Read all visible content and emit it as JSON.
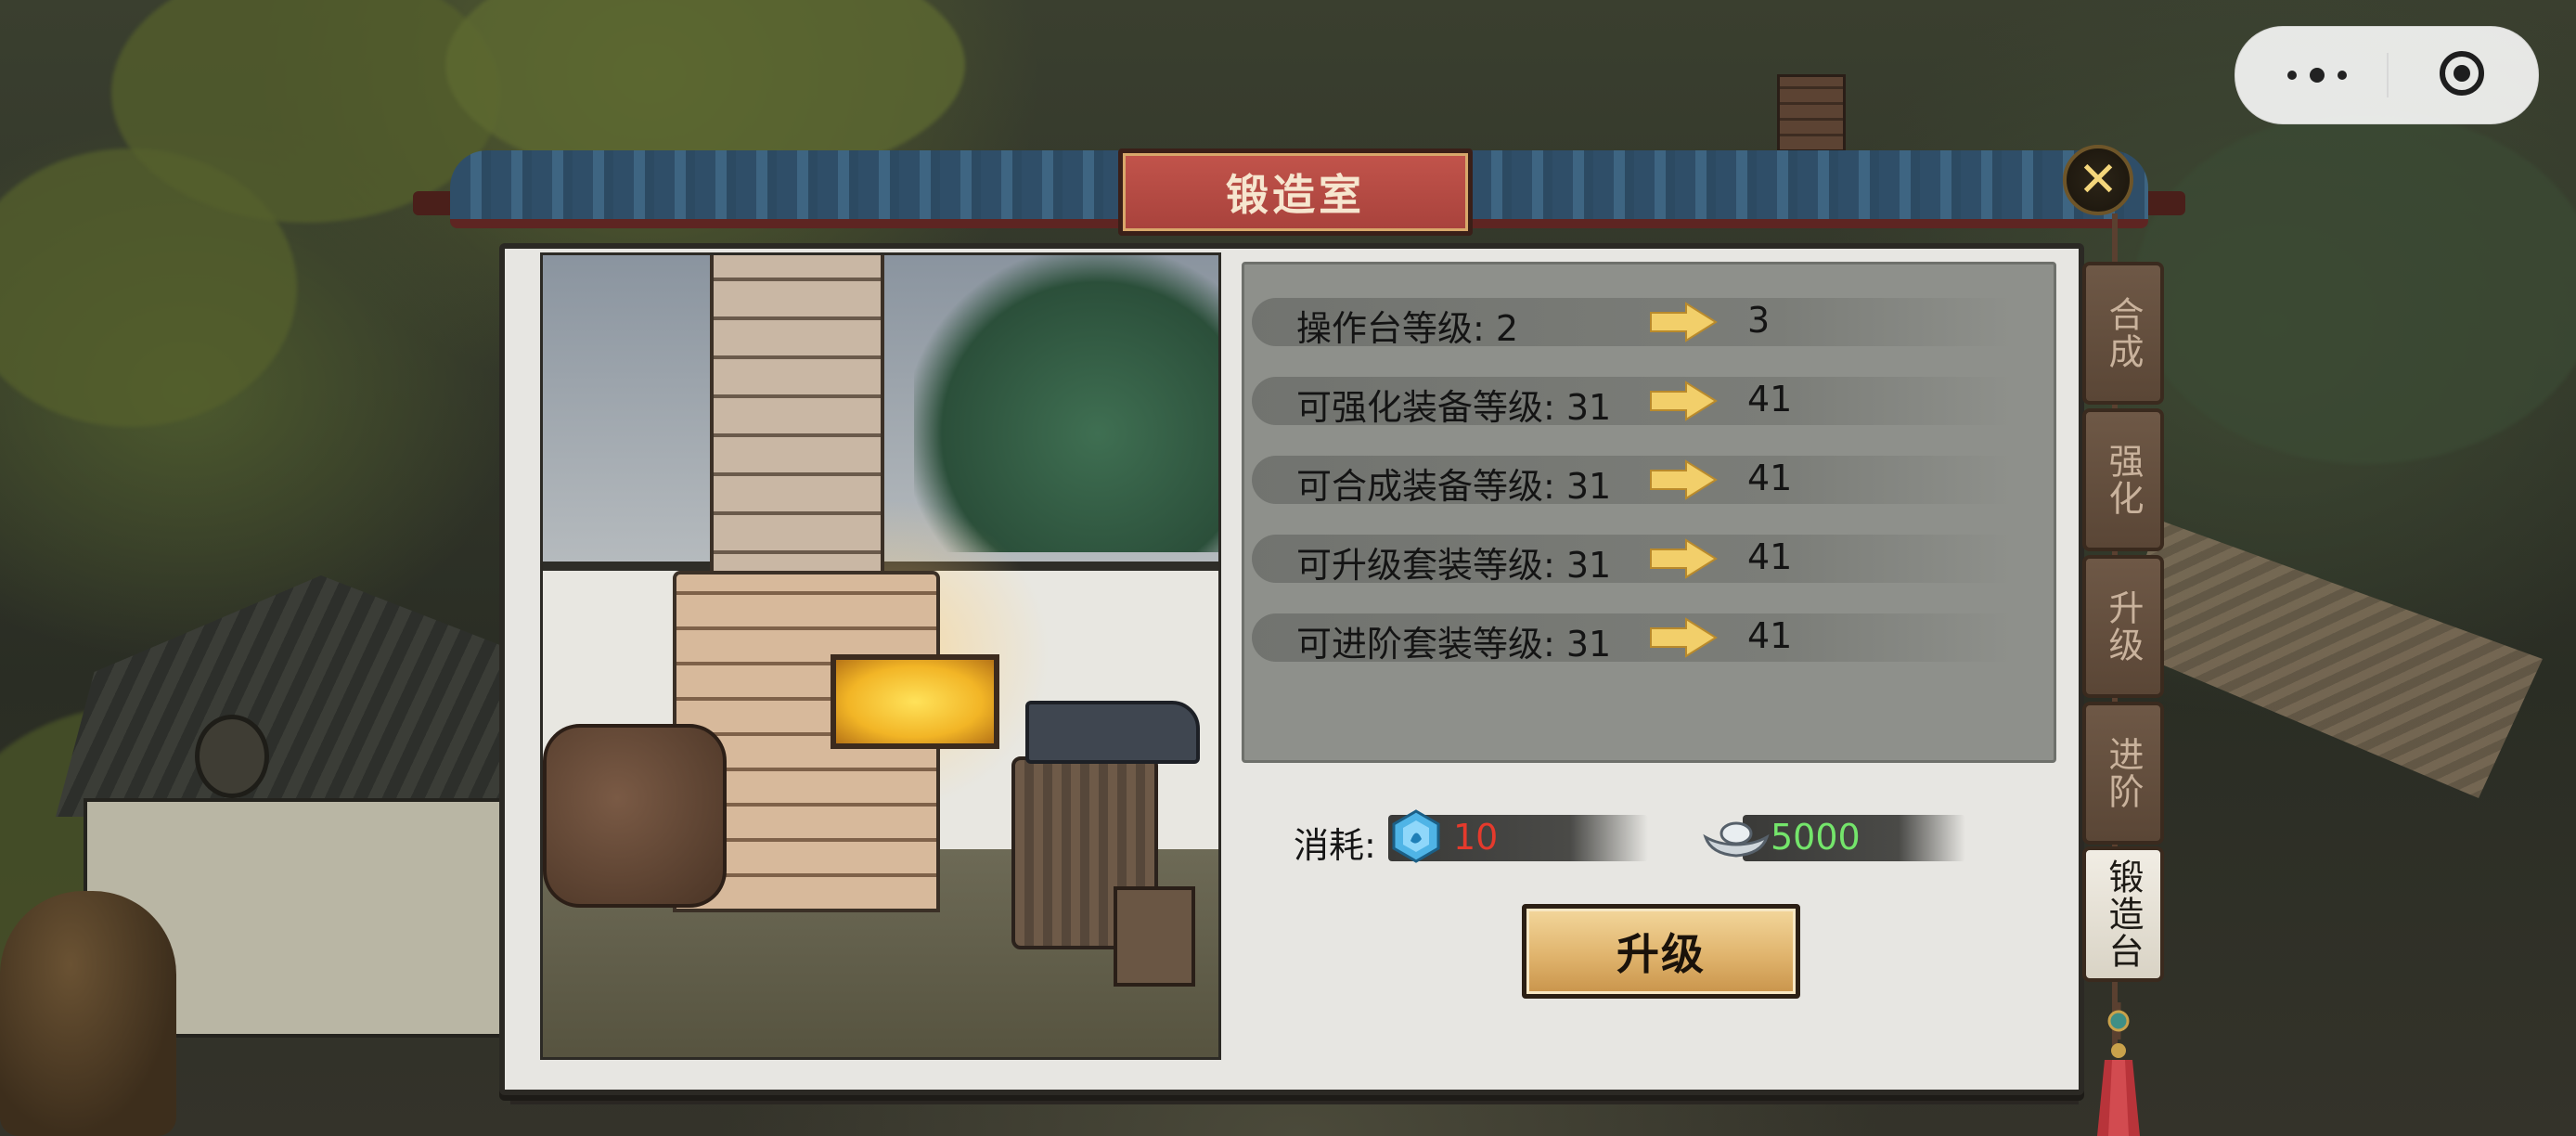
{
  "window": {
    "title": "锻造室"
  },
  "stats": [
    {
      "label": "操作台等级: 2",
      "next": "3"
    },
    {
      "label": "可强化装备等级:  31",
      "next": "41"
    },
    {
      "label": "可合成装备等级:  31",
      "next": "41"
    },
    {
      "label": "可升级套装等级:  31",
      "next": "41"
    },
    {
      "label": "可进阶套装等级:  31",
      "next": "41"
    }
  ],
  "cost": {
    "label": "消耗:",
    "gem": {
      "value": "10",
      "icon": "blue-gem-icon",
      "color": "#e53a2c"
    },
    "silver": {
      "value": "5000",
      "icon": "silver-ingot-icon",
      "color": "#74e56b"
    }
  },
  "actions": {
    "upgrade_label": "升级",
    "close_icon": "close-x-icon"
  },
  "tabs": [
    {
      "label": "合成",
      "active": false
    },
    {
      "label": "强化",
      "active": false
    },
    {
      "label": "升级",
      "active": false
    },
    {
      "label": "进阶",
      "active": false
    },
    {
      "label": "锻造台",
      "active": true
    }
  ],
  "capsule": {
    "more_icon": "more-dots-icon",
    "exit_icon": "target-circle-icon"
  },
  "colors": {
    "title_plate": "#b3463f",
    "button": "#e0b46d",
    "gem_text": "#e53a2c",
    "silver_text": "#74e56b"
  }
}
